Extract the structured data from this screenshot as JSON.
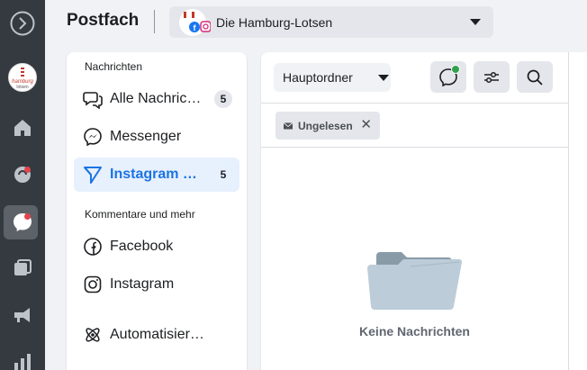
{
  "header": {
    "title": "Postfach",
    "account_name": "Die Hamburg-Lotsen"
  },
  "rail": {
    "avatar_text": "hamburg lotsen"
  },
  "nav": {
    "section_messages": "Nachrichten",
    "section_comments": "Kommentare und mehr",
    "items": [
      {
        "label": "Alle Nachrichten",
        "count": "5"
      },
      {
        "label": "Messenger"
      },
      {
        "label": "Instagram Direct",
        "count": "5"
      },
      {
        "label": "Facebook"
      },
      {
        "label": "Instagram"
      },
      {
        "label": "Automatisierte Antworten"
      }
    ]
  },
  "main": {
    "folder_label": "Hauptordner",
    "filter_chip": "Ungelesen",
    "chip_close": "✕",
    "empty_text": "Keine Nachrichten"
  },
  "colors": {
    "accent": "#1b74e4",
    "rail": "#343a40",
    "notification": "#e4434a",
    "online": "#31a24c"
  }
}
